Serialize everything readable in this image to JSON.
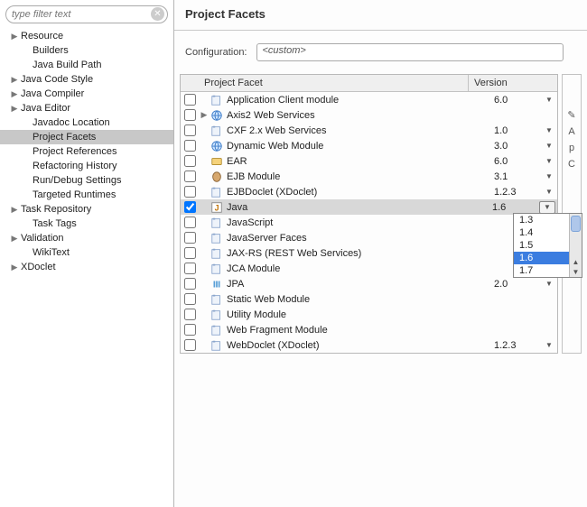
{
  "filter": {
    "placeholder": "type filter text",
    "clear_glyph": "✕"
  },
  "panel": {
    "title": "Project Facets",
    "config_label": "Configuration:",
    "config_value": "<custom>"
  },
  "sidebar": {
    "items": [
      {
        "label": "Resource",
        "expandable": true,
        "indent": 0
      },
      {
        "label": "Builders",
        "expandable": false,
        "indent": 1
      },
      {
        "label": "Java Build Path",
        "expandable": false,
        "indent": 1
      },
      {
        "label": "Java Code Style",
        "expandable": true,
        "indent": 0
      },
      {
        "label": "Java Compiler",
        "expandable": true,
        "indent": 0
      },
      {
        "label": "Java Editor",
        "expandable": true,
        "indent": 0
      },
      {
        "label": "Javadoc Location",
        "expandable": false,
        "indent": 1
      },
      {
        "label": "Project Facets",
        "expandable": false,
        "indent": 1,
        "selected": true
      },
      {
        "label": "Project References",
        "expandable": false,
        "indent": 1
      },
      {
        "label": "Refactoring History",
        "expandable": false,
        "indent": 1
      },
      {
        "label": "Run/Debug Settings",
        "expandable": false,
        "indent": 1
      },
      {
        "label": "Targeted Runtimes",
        "expandable": false,
        "indent": 1
      },
      {
        "label": "Task Repository",
        "expandable": true,
        "indent": 0
      },
      {
        "label": "Task Tags",
        "expandable": false,
        "indent": 1
      },
      {
        "label": "Validation",
        "expandable": true,
        "indent": 0
      },
      {
        "label": "WikiText",
        "expandable": false,
        "indent": 1
      },
      {
        "label": "XDoclet",
        "expandable": true,
        "indent": 0
      }
    ]
  },
  "facets": {
    "head": {
      "facet": "Project Facet",
      "version": "Version"
    },
    "rows": [
      {
        "label": "Application Client module",
        "checked": false,
        "version": "6.0",
        "hasDropdown": true,
        "icon": "module"
      },
      {
        "label": "Axis2 Web Services",
        "checked": false,
        "version": "",
        "hasDropdown": false,
        "icon": "globe",
        "expandable": true
      },
      {
        "label": "CXF 2.x Web Services",
        "checked": false,
        "version": "1.0",
        "hasDropdown": true,
        "icon": "module"
      },
      {
        "label": "Dynamic Web Module",
        "checked": false,
        "version": "3.0",
        "hasDropdown": true,
        "icon": "globe"
      },
      {
        "label": "EAR",
        "checked": false,
        "version": "6.0",
        "hasDropdown": true,
        "icon": "ear"
      },
      {
        "label": "EJB Module",
        "checked": false,
        "version": "3.1",
        "hasDropdown": true,
        "icon": "bean"
      },
      {
        "label": "EJBDoclet (XDoclet)",
        "checked": false,
        "version": "1.2.3",
        "hasDropdown": true,
        "icon": "module"
      },
      {
        "label": "Java",
        "checked": true,
        "version": "1.6",
        "hasDropdown": true,
        "icon": "java",
        "selected": true,
        "ddboxed": true
      },
      {
        "label": "JavaScript",
        "checked": false,
        "version": "",
        "hasDropdown": false,
        "icon": "module"
      },
      {
        "label": "JavaServer Faces",
        "checked": false,
        "version": "",
        "hasDropdown": false,
        "icon": "module"
      },
      {
        "label": "JAX-RS (REST Web Services)",
        "checked": false,
        "version": "",
        "hasDropdown": false,
        "icon": "module"
      },
      {
        "label": "JCA Module",
        "checked": false,
        "version": "",
        "hasDropdown": false,
        "icon": "module"
      },
      {
        "label": "JPA",
        "checked": false,
        "version": "2.0",
        "hasDropdown": true,
        "icon": "jpa"
      },
      {
        "label": "Static Web Module",
        "checked": false,
        "version": "",
        "hasDropdown": false,
        "icon": "module"
      },
      {
        "label": "Utility Module",
        "checked": false,
        "version": "",
        "hasDropdown": false,
        "icon": "module"
      },
      {
        "label": "Web Fragment Module",
        "checked": false,
        "version": "",
        "hasDropdown": false,
        "icon": "module"
      },
      {
        "label": "WebDoclet (XDoclet)",
        "checked": false,
        "version": "1.2.3",
        "hasDropdown": true,
        "icon": "module"
      }
    ]
  },
  "dropdown": {
    "options": [
      {
        "label": "1.3"
      },
      {
        "label": "1.4"
      },
      {
        "label": "1.5"
      },
      {
        "label": "1.6",
        "highlight": true
      },
      {
        "label": "1.7"
      }
    ]
  },
  "right_hint": {
    "items": [
      "✎",
      "A",
      "p",
      "C"
    ]
  }
}
